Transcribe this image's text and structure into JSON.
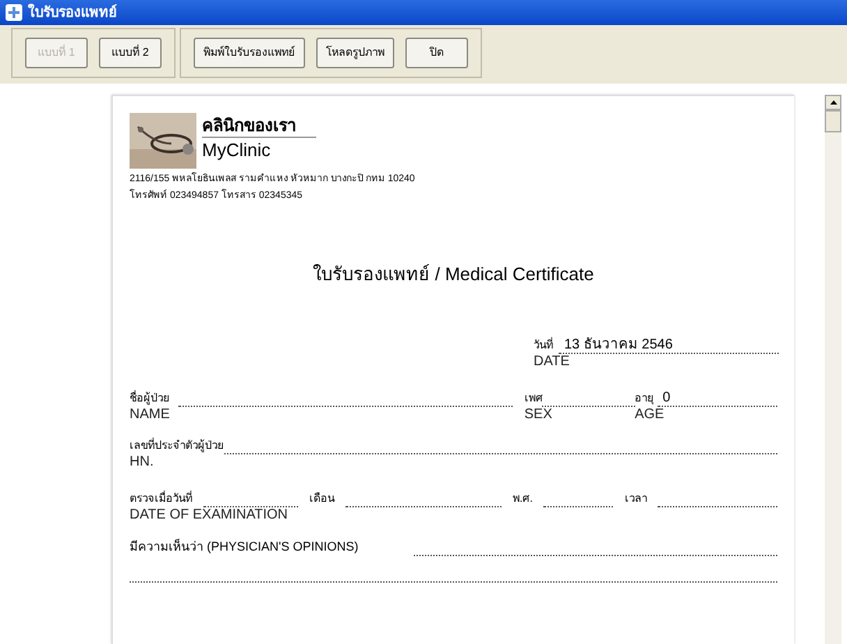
{
  "window": {
    "title": "ใบรับรองแพทย์"
  },
  "toolbar": {
    "groups": [
      [
        {
          "label": "แบบที่ 1",
          "disabled": true
        },
        {
          "label": "แบบที่ 2",
          "disabled": false
        }
      ],
      [
        {
          "label": "พิมพ์ใบรับรองแพทย์",
          "disabled": false
        },
        {
          "label": "โหลดรูปภาพ",
          "disabled": false
        },
        {
          "label": "ปิด",
          "disabled": false
        }
      ]
    ]
  },
  "clinic": {
    "name_th": "คลินิกของเรา",
    "name_en": "MyClinic",
    "address": "2116/155 พหลโยธินเพลส รามคำแหง หัวหมาก บางกะปิ กทม 10240",
    "phone": "โทรศัพท์ 023494857 โทรสาร 02345345"
  },
  "document_title": "ใบรับรองแพทย์  /  Medical Certificate",
  "date": {
    "label": "วันที่",
    "value": "13 ธันวาคม 2546",
    "label_en": "DATE"
  },
  "name": {
    "label": "ชื่อผู้ป่วย",
    "label_en": "NAME"
  },
  "sex": {
    "label": "เพศ",
    "label_en": "SEX"
  },
  "age": {
    "label": "อายุ",
    "value": "0",
    "label_en": "AGE"
  },
  "hn": {
    "label": "เลขที่ประจำตัวผู้ป่วย",
    "label_en": "HN."
  },
  "exam": {
    "label": "ตรวจเมื่อวันที่",
    "month": "เดือน",
    "year": "พ.ศ.",
    "time": "เวลา",
    "label_en": "DATE OF EXAMINATION"
  },
  "opinion": {
    "label": "มีความเห็นว่า (PHYSICIAN'S OPINIONS)"
  }
}
